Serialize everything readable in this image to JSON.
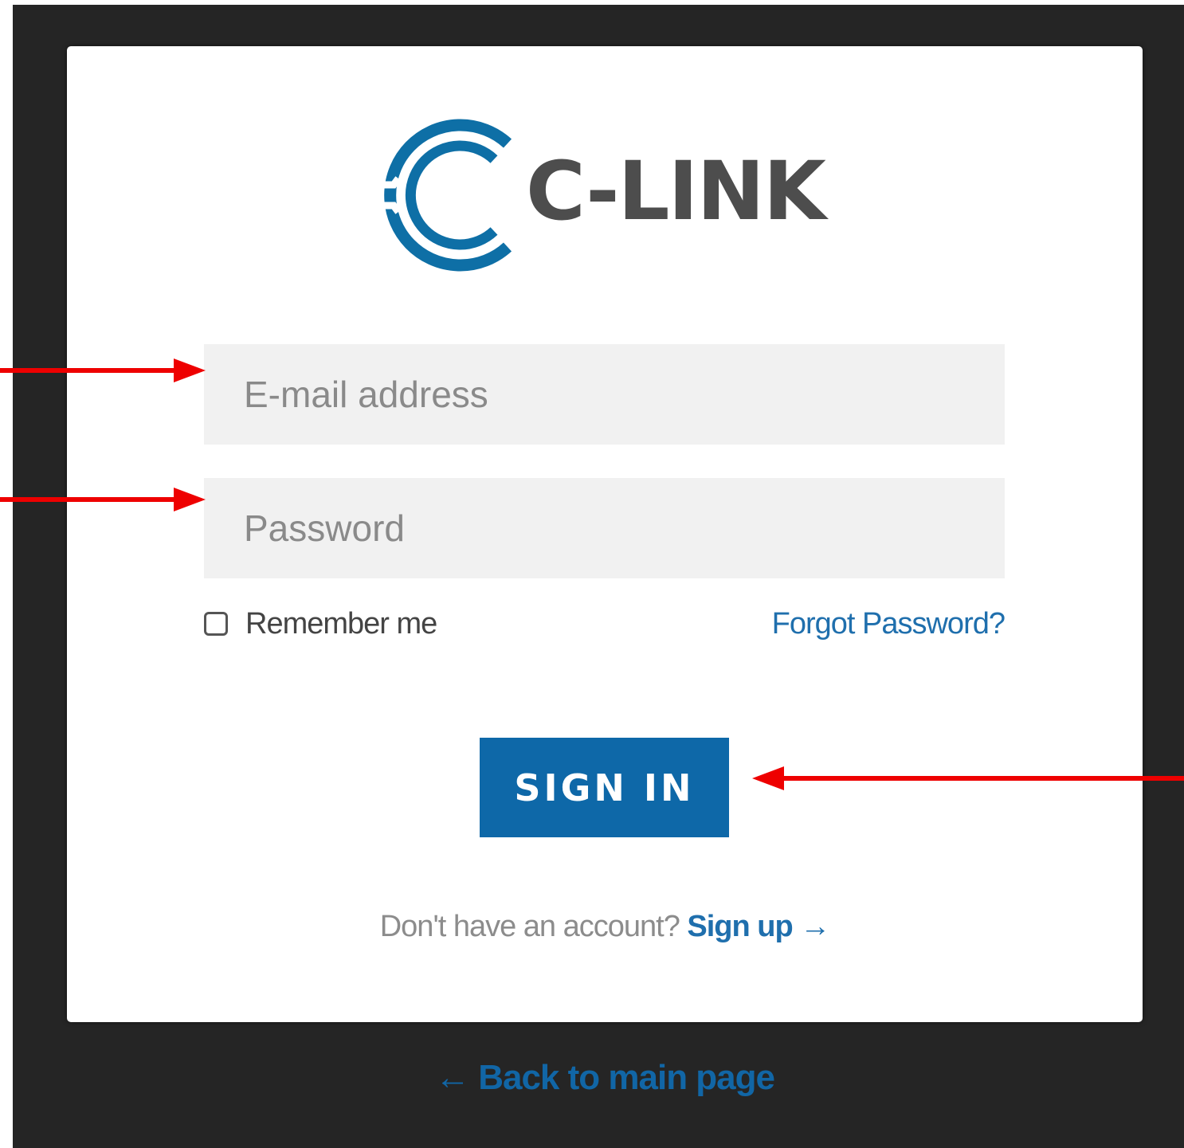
{
  "logo": {
    "text": "C-LINK",
    "brand_color": "#0e6fa6",
    "text_color": "#4d4d4d"
  },
  "form": {
    "email_placeholder": "E-mail address",
    "password_placeholder": "Password",
    "remember_label": "Remember me",
    "remember_checked": false,
    "forgot_label": "Forgot Password?",
    "submit_label": "SIGN IN"
  },
  "signup": {
    "prompt": "Don't have an account?",
    "link_label": "Sign up →"
  },
  "back": {
    "label": "← Back to main page"
  },
  "annotations": {
    "arrow_color": "#ee0000",
    "arrows": [
      "arrow-to-email",
      "arrow-to-password",
      "arrow-to-sign-in"
    ]
  },
  "colors": {
    "page_background": "#252525",
    "card_background": "#ffffff",
    "input_background": "#f1f1f1",
    "primary_button": "#0e68a8",
    "link": "#1f6fad"
  }
}
